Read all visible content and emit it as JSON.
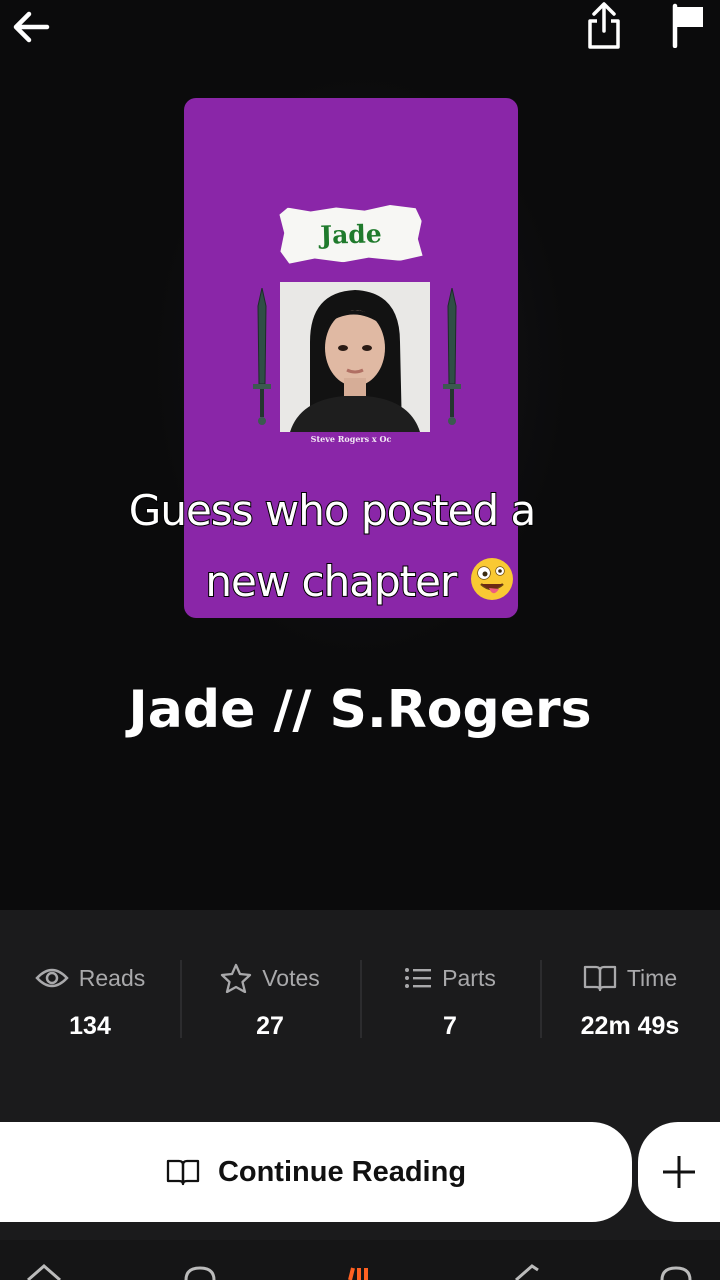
{
  "story": {
    "title": "Jade // S.Rogers",
    "cover": {
      "title": "Jade",
      "author_line": "Steve Rogers x Oc",
      "background": "#8a26a8"
    }
  },
  "overlay_caption": {
    "line1": "Guess who posted a",
    "line2": "new chapter",
    "emoji": "zany-face"
  },
  "stats": [
    {
      "icon": "eye-icon",
      "label": "Reads",
      "value": "134"
    },
    {
      "icon": "star-icon",
      "label": "Votes",
      "value": "27"
    },
    {
      "icon": "list-icon",
      "label": "Parts",
      "value": "7"
    },
    {
      "icon": "book-icon",
      "label": "Time",
      "value": "22m 49s"
    }
  ],
  "actions": {
    "continue_label": "Continue Reading",
    "add_label": "+"
  },
  "colors": {
    "background": "#0b0b0c",
    "panel": "#1b1b1c",
    "accent": "#ff6122"
  }
}
